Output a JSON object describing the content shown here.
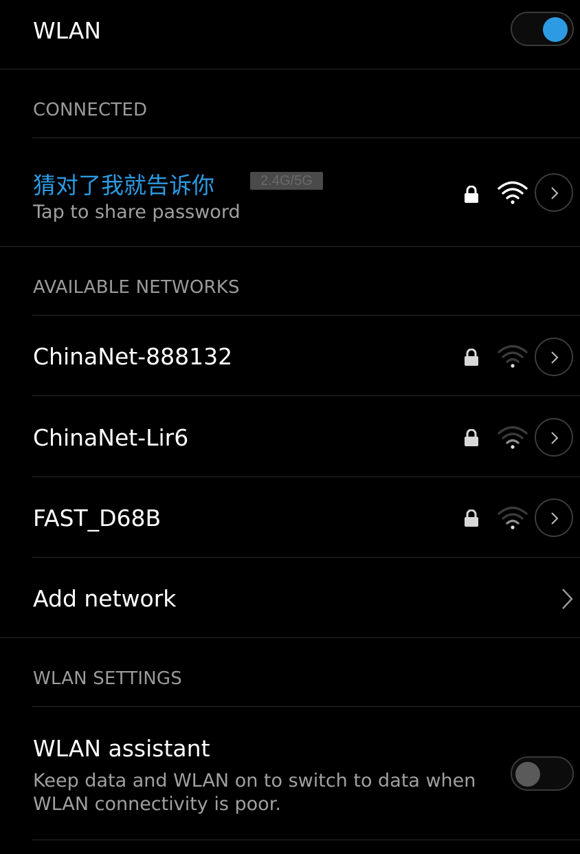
{
  "wlan_toggle": {
    "label": "WLAN",
    "state": "on"
  },
  "connected": {
    "header": "CONNECTED",
    "ssid": "猜对了我就告诉你",
    "band": "2.4G/5G",
    "subtitle": "Tap to share password",
    "ssid_color": "#2d9be3",
    "secured": true,
    "signal_level": "full"
  },
  "available": {
    "header": "AVAILABLE NETWORKS",
    "networks": [
      {
        "ssid": "ChinaNet-888132",
        "secured": true,
        "signal_level": "weak"
      },
      {
        "ssid": "ChinaNet-Lir6",
        "secured": true,
        "signal_level": "weak"
      },
      {
        "ssid": "FAST_D68B",
        "secured": true,
        "signal_level": "weak"
      }
    ],
    "add_network_label": "Add network"
  },
  "settings": {
    "header": "WLAN SETTINGS",
    "assistant_title": "WLAN assistant",
    "assistant_desc_line1": "Keep data and WLAN on to switch to data when",
    "assistant_desc_line2": "WLAN connectivity is poor.",
    "assistant_state": "off"
  },
  "colors": {
    "accent": "#2d9be3",
    "background": "#000000",
    "text_primary": "#ffffff",
    "text_secondary": "#9b9b9b"
  },
  "icons": {
    "lock": "lock-icon",
    "wifi": "wifi-signal-icon",
    "detail": "chevron-right-icon"
  }
}
